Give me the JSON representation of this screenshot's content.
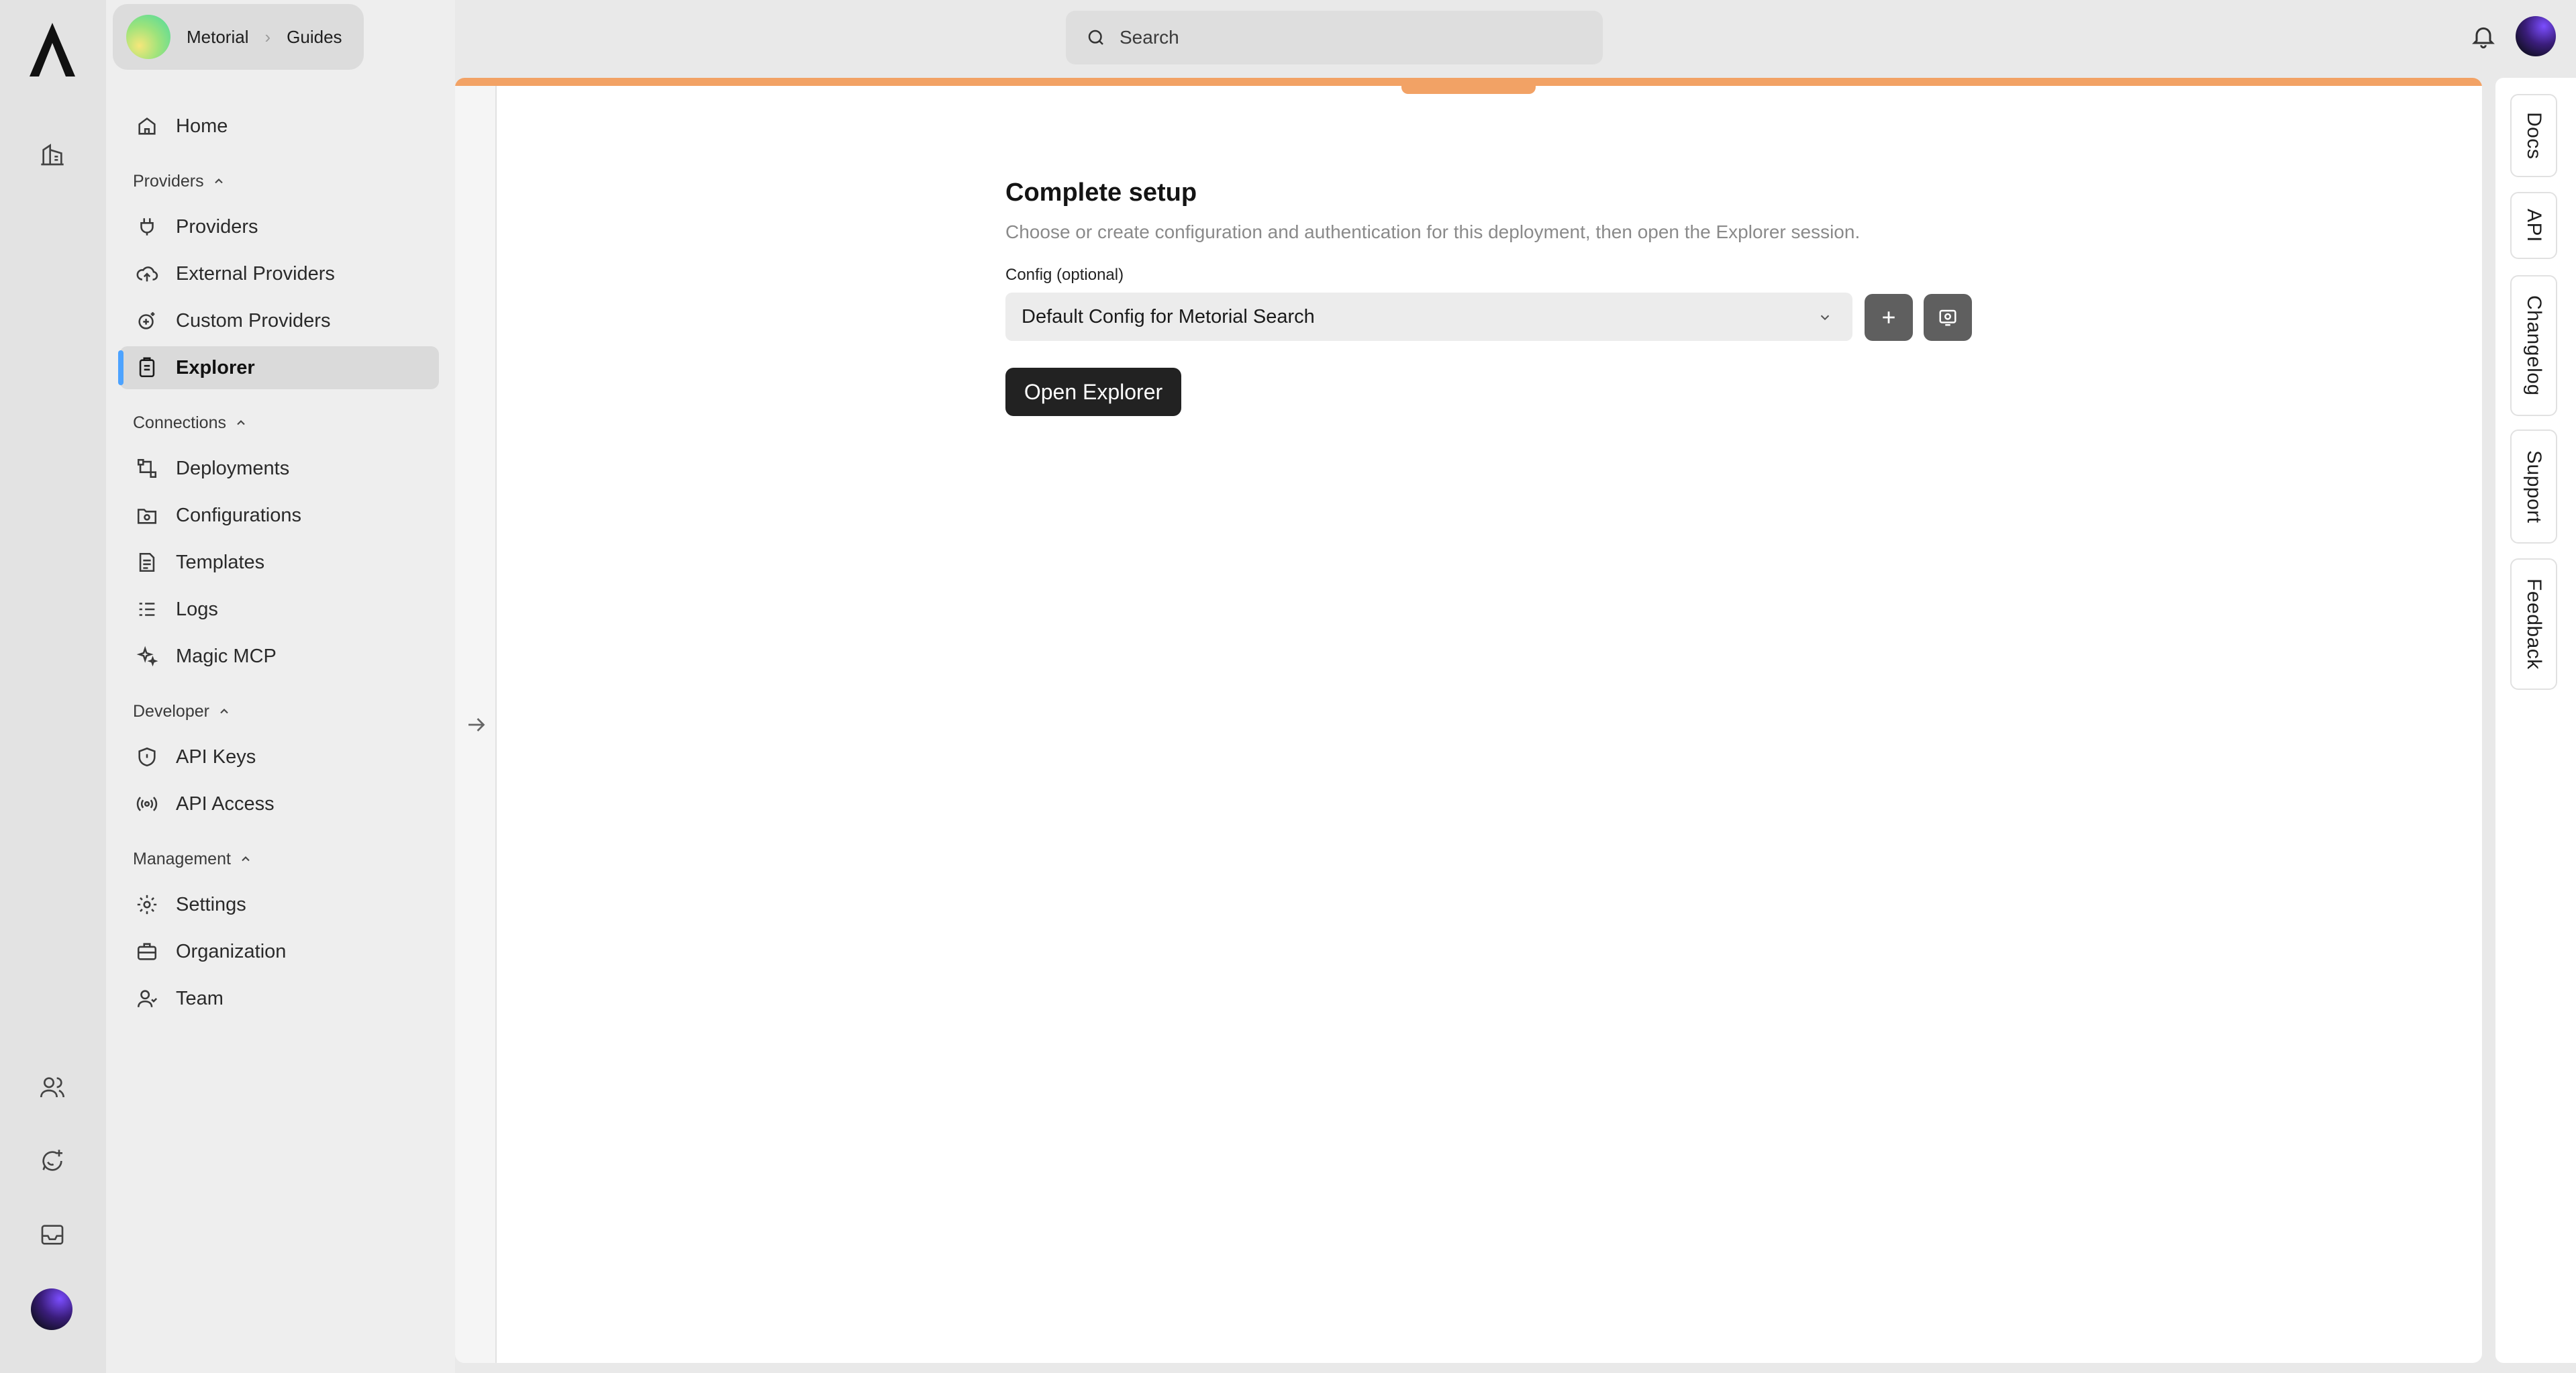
{
  "breadcrumb": {
    "org": "Metorial",
    "page": "Guides"
  },
  "search": {
    "placeholder": "Search"
  },
  "sidebar": {
    "home": "Home",
    "sections": {
      "providers": "Providers",
      "connections": "Connections",
      "developer": "Developer",
      "management": "Management"
    },
    "items": {
      "providers": "Providers",
      "external_providers": "External Providers",
      "custom_providers": "Custom Providers",
      "explorer": "Explorer",
      "deployments": "Deployments",
      "configurations": "Configurations",
      "templates": "Templates",
      "logs": "Logs",
      "magic_mcp": "Magic MCP",
      "api_keys": "API Keys",
      "api_access": "API Access",
      "settings": "Settings",
      "organization": "Organization",
      "team": "Team"
    },
    "active": "Explorer"
  },
  "main": {
    "title": "Complete setup",
    "description": "Choose or create configuration and authentication for this deployment, then open the Explorer session.",
    "config_label": "Config (optional)",
    "config_value": "Default Config for Metorial Search",
    "open_button": "Open Explorer"
  },
  "right_tabs": [
    "Docs",
    "API",
    "Changelog",
    "Support",
    "Feedback"
  ],
  "colors": {
    "accent_bar": "#f2a265",
    "active_indicator": "#4da3ff",
    "primary_button": "#222222"
  }
}
